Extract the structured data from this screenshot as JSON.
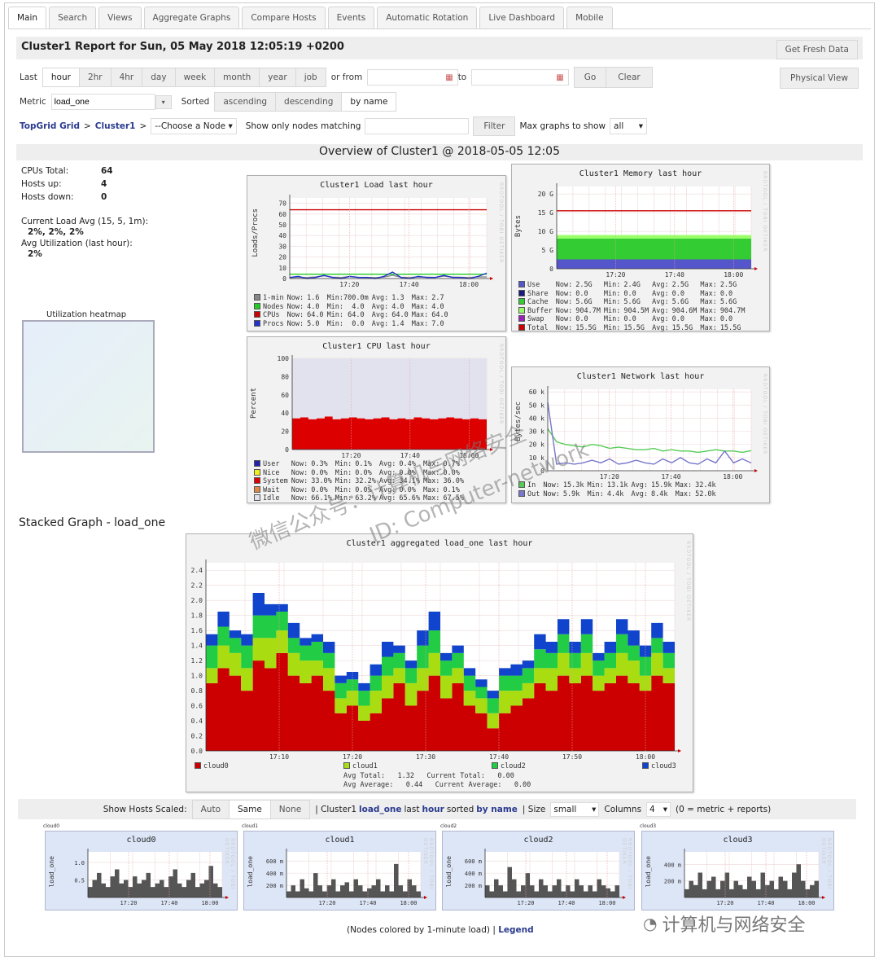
{
  "tabs": [
    "Main",
    "Search",
    "Views",
    "Aggregate Graphs",
    "Compare Hosts",
    "Events",
    "Automatic Rotation",
    "Live Dashboard",
    "Mobile"
  ],
  "header": {
    "title": "Cluster1 Report for Sun, 05 May 2018 12:05:19 +0200",
    "fresh": "Get Fresh Data",
    "physical": "Physical View"
  },
  "controls": {
    "last_label": "Last",
    "ranges": [
      "hour",
      "2hr",
      "4hr",
      "day",
      "week",
      "month",
      "year",
      "job"
    ],
    "active_range": "hour",
    "or_from": "or from",
    "to": "to",
    "go": "Go",
    "clear": "Clear",
    "metric_label": "Metric",
    "metric_value": "load_one",
    "sorted_label": "Sorted",
    "sorts": [
      "ascending",
      "descending",
      "by name"
    ],
    "active_sort": "by name",
    "crumb_grid": "TopGrid Grid",
    "crumb_sep": ">",
    "crumb_cluster": "Cluster1",
    "node_select": "--Choose a Node",
    "filter_label": "Show only nodes matching",
    "filter_btn": "Filter",
    "max_label": "Max graphs to show",
    "max_value": "all"
  },
  "overview": {
    "title": "Overview of Cluster1 @ 2018-05-05 12:05",
    "stats": [
      [
        "CPUs Total:",
        "64"
      ],
      [
        "Hosts up:",
        "4"
      ],
      [
        "Hosts down:",
        "0"
      ]
    ],
    "load_label": "Current Load Avg (15, 5, 1m):",
    "load_value": "2%, 2%, 2%",
    "util_label": "Avg Utilization (last hour):",
    "util_value": "2%",
    "heatmap_label": "Utilization heatmap"
  },
  "graphs": {
    "load": {
      "title": "Cluster1 Load last hour",
      "ylabel": "Loads/Procs",
      "ymax": 75,
      "yticks": [
        [
          0,
          "0"
        ],
        [
          10,
          "10"
        ],
        [
          20,
          "20"
        ],
        [
          30,
          "30"
        ],
        [
          40,
          "40"
        ],
        [
          50,
          "50"
        ],
        [
          60,
          "60"
        ],
        [
          70,
          "70"
        ]
      ],
      "xticks": [
        "17:20",
        "17:40",
        "18:00"
      ],
      "series": [
        {
          "name": "1-min",
          "color": "#888888",
          "type": "line",
          "values": [
            0.8,
            1.2,
            1.0,
            1.5,
            2.5,
            1.3,
            1.0,
            1.8,
            1.2,
            1.1,
            0.9,
            1.4,
            3.0,
            1.2,
            1.0,
            1.5,
            1.3,
            1.1,
            2.2,
            1.4,
            1.2,
            1.0,
            1.6,
            1.5
          ]
        },
        {
          "name": "Nodes",
          "color": "#22cc22",
          "type": "line",
          "values": [
            4,
            4
          ]
        },
        {
          "name": "CPUs",
          "color": "#cc0000",
          "type": "line",
          "values": [
            64,
            64
          ]
        },
        {
          "name": "Procs",
          "color": "#2233cc",
          "type": "line",
          "values": [
            1,
            2,
            0,
            1,
            3,
            1,
            0,
            2,
            1,
            1,
            0,
            2,
            6,
            1,
            0,
            2,
            1,
            1,
            3,
            1,
            1,
            0,
            2,
            5
          ]
        }
      ],
      "legend": [
        [
          "1-min",
          "Now:",
          "1.6",
          "Min:700.0m",
          "Avg:",
          "1.3",
          "Max:",
          "2.7"
        ],
        [
          "Nodes",
          "Now:",
          "4.0",
          "Min:  4.0",
          "Avg:",
          "4.0",
          "Max:",
          "4.0"
        ],
        [
          "CPUs",
          "Now:",
          "64.0",
          "Min: 64.0",
          "Avg:",
          "64.0",
          "Max:",
          "64.0"
        ],
        [
          "Procs",
          "Now:",
          "5.0",
          "Min:  0.0",
          "Avg:",
          "1.4",
          "Max:",
          "7.0"
        ]
      ]
    },
    "memory": {
      "title": "Cluster1 Memory last hour",
      "ylabel": "Bytes",
      "ymax": 22,
      "yticks": [
        [
          0,
          "0"
        ],
        [
          5,
          "5 G"
        ],
        [
          10,
          "10 G"
        ],
        [
          15,
          "15 G"
        ],
        [
          20,
          "20 G"
        ]
      ],
      "xticks": [
        "17:20",
        "17:40",
        "18:00"
      ],
      "series": [
        {
          "name": "Use",
          "color": "#5555cc",
          "type": "stack",
          "values": [
            2.5,
            2.5
          ]
        },
        {
          "name": "Share",
          "color": "#1a1a7a",
          "type": "stack",
          "values": [
            0,
            0
          ]
        },
        {
          "name": "Cache",
          "color": "#33cc33",
          "type": "stack",
          "values": [
            5.6,
            5.6
          ]
        },
        {
          "name": "Buffer",
          "color": "#99ff66",
          "type": "stack",
          "values": [
            0.9,
            0.9
          ]
        },
        {
          "name": "Swap",
          "color": "#9922bb",
          "type": "stack",
          "values": [
            0,
            0
          ]
        },
        {
          "name": "Total",
          "color": "#cc0000",
          "type": "line",
          "values": [
            15.5,
            15.5
          ]
        }
      ],
      "legend": [
        [
          "Use",
          "Now:",
          "2.5G",
          "Min:",
          "2.4G",
          "Avg:",
          "2.5G",
          "Max:",
          "2.5G"
        ],
        [
          "Share",
          "Now:",
          "0.0",
          "Min:",
          "0.0",
          "Avg:",
          "0.0",
          "Max:",
          "0.0"
        ],
        [
          "Cache",
          "Now:",
          "5.6G",
          "Min:",
          "5.6G",
          "Avg:",
          "5.6G",
          "Max:",
          "5.6G"
        ],
        [
          "Buffer",
          "Now:",
          "904.7M",
          "Min:",
          "904.5M",
          "Avg:",
          "904.6M",
          "Max:",
          "904.7M"
        ],
        [
          "Swap",
          "Now:",
          "0.0",
          "Min:",
          "0.0",
          "Avg:",
          "0.0",
          "Max:",
          "0.0"
        ],
        [
          "Total",
          "Now:",
          "15.5G",
          "Min:",
          "15.5G",
          "Avg:",
          "15.5G",
          "Max:",
          "15.5G"
        ]
      ]
    },
    "cpu": {
      "title": "Cluster1 CPU last hour",
      "ylabel": "Percent",
      "ymax": 100,
      "yticks": [
        [
          0,
          "0"
        ],
        [
          20,
          "20"
        ],
        [
          40,
          "40"
        ],
        [
          60,
          "60"
        ],
        [
          80,
          "80"
        ],
        [
          100,
          "100"
        ]
      ],
      "xticks": [
        "17:20",
        "17:40",
        "18:00"
      ],
      "series": [
        {
          "name": "User",
          "color": "#2222aa",
          "type": "stack",
          "values": [
            0.3,
            0.3
          ]
        },
        {
          "name": "Nice",
          "color": "#eeee22",
          "type": "stack",
          "values": [
            0,
            0
          ]
        },
        {
          "name": "System",
          "color": "#dd0000",
          "type": "stack",
          "values": [
            34,
            35,
            33,
            34,
            36,
            33,
            34,
            35,
            34,
            33,
            34,
            35,
            33,
            34,
            33,
            35,
            34,
            33,
            34,
            35,
            34,
            33,
            34,
            33
          ]
        },
        {
          "name": "Wait",
          "color": "#dd8844",
          "type": "stack",
          "values": [
            0,
            0
          ]
        },
        {
          "name": "Idle",
          "color": "#e2e2ee",
          "type": "fill",
          "values": [
            100,
            100
          ]
        }
      ],
      "legend": [
        [
          "User",
          "Now:",
          "0.3%",
          "Min:",
          "0.1%",
          "Avg:",
          "0.4%",
          "Max:",
          "0.7%"
        ],
        [
          "Nice",
          "Now:",
          "0.0%",
          "Min:",
          "0.0%",
          "Avg:",
          "0.0%",
          "Max:",
          "0.0%"
        ],
        [
          "System",
          "Now:",
          "33.0%",
          "Min:",
          "32.2%",
          "Avg:",
          "34.1%",
          "Max:",
          "36.0%"
        ],
        [
          "Wait",
          "Now:",
          "0.0%",
          "Min:",
          "0.0%",
          "Avg:",
          "0.0%",
          "Max:",
          "0.1%"
        ],
        [
          "Idle",
          "Now:",
          "66.1%",
          "Min:",
          "63.2%",
          "Avg:",
          "65.6%",
          "Max:",
          "67.5%"
        ]
      ]
    },
    "network": {
      "title": "Cluster1 Network last hour",
      "ylabel": "Bytes/sec",
      "ymax": 62,
      "yticks": [
        [
          0,
          "0"
        ],
        [
          10,
          "10 k"
        ],
        [
          20,
          "20 k"
        ],
        [
          30,
          "30 k"
        ],
        [
          40,
          "40 k"
        ],
        [
          50,
          "50 k"
        ],
        [
          60,
          "60 k"
        ]
      ],
      "xticks": [
        "17:20",
        "17:40",
        "18:00"
      ],
      "series": [
        {
          "name": "In",
          "color": "#55cc55",
          "type": "line",
          "values": [
            32,
            22,
            20,
            19,
            18,
            20,
            19,
            17,
            18,
            17,
            16,
            16,
            17,
            15,
            16,
            15,
            15,
            14,
            15,
            16,
            15,
            15,
            14,
            15.3
          ]
        },
        {
          "name": "Out",
          "color": "#7777cc",
          "type": "line",
          "values": [
            52,
            5,
            6,
            5,
            6,
            8,
            6,
            9,
            5,
            6,
            8,
            6,
            5,
            9,
            6,
            10,
            6,
            5,
            9,
            6,
            15,
            6,
            9,
            5.9
          ]
        }
      ],
      "legend": [
        [
          "In",
          "Now:",
          "15.3k",
          "Min:",
          "13.1k",
          "Avg:",
          "15.9k",
          "Max:",
          "32.4k"
        ],
        [
          "Out",
          "Now:",
          "5.9k",
          "Min:",
          "4.4k",
          "Avg:",
          "8.4k",
          "Max:",
          "52.0k"
        ]
      ]
    },
    "stacked": {
      "title": "Cluster1 aggregated load_one last hour",
      "ymax": 2.5,
      "yticks": [
        [
          0,
          "0.0"
        ],
        [
          0.2,
          "0.2"
        ],
        [
          0.4,
          "0.4"
        ],
        [
          0.6,
          "0.6"
        ],
        [
          0.8,
          "0.8"
        ],
        [
          1.0,
          "1.0"
        ],
        [
          1.2,
          "1.2"
        ],
        [
          1.4,
          "1.4"
        ],
        [
          1.6,
          "1.6"
        ],
        [
          1.8,
          "1.8"
        ],
        [
          2.0,
          "2.0"
        ],
        [
          2.2,
          "2.2"
        ],
        [
          2.4,
          "2.4"
        ]
      ],
      "xticks": [
        "17:10",
        "17:20",
        "17:30",
        "17:40",
        "17:50",
        "18:00"
      ],
      "series": [
        {
          "name": "cloud0",
          "color": "#cc0000",
          "type": "stack",
          "values": [
            0.9,
            1.1,
            1.0,
            0.8,
            1.2,
            1.1,
            1.3,
            1.0,
            0.9,
            1.0,
            0.8,
            0.5,
            0.6,
            0.4,
            0.5,
            0.7,
            0.9,
            0.6,
            0.8,
            1.0,
            0.7,
            0.9,
            0.6,
            0.5,
            0.3,
            0.5,
            0.6,
            0.7,
            0.9,
            0.8,
            1.0,
            0.9,
            1.0,
            0.8,
            0.9,
            1.0,
            0.9,
            0.8,
            1.0,
            0.9
          ]
        },
        {
          "name": "cloud1",
          "color": "#aadd11",
          "type": "stack",
          "values": [
            0.2,
            0.3,
            0.3,
            0.3,
            0.3,
            0.4,
            0.3,
            0.3,
            0.3,
            0.2,
            0.3,
            0.2,
            0.2,
            0.2,
            0.3,
            0.3,
            0.2,
            0.3,
            0.3,
            0.3,
            0.3,
            0.2,
            0.2,
            0.2,
            0.2,
            0.3,
            0.2,
            0.2,
            0.2,
            0.3,
            0.3,
            0.2,
            0.3,
            0.2,
            0.2,
            0.3,
            0.3,
            0.2,
            0.3,
            0.2
          ]
        },
        {
          "name": "cloud2",
          "color": "#22cc44",
          "type": "stack",
          "values": [
            0.3,
            0.25,
            0.2,
            0.3,
            0.3,
            0.3,
            0.25,
            0.2,
            0.2,
            0.25,
            0.2,
            0.2,
            0.15,
            0.2,
            0.2,
            0.25,
            0.2,
            0.2,
            0.3,
            0.3,
            0.2,
            0.2,
            0.2,
            0.15,
            0.2,
            0.2,
            0.2,
            0.2,
            0.25,
            0.2,
            0.25,
            0.2,
            0.25,
            0.2,
            0.2,
            0.25,
            0.2,
            0.25,
            0.2,
            0.2
          ]
        },
        {
          "name": "cloud3",
          "color": "#1144cc",
          "type": "stack",
          "values": [
            0.15,
            0.2,
            0.1,
            0.15,
            0.3,
            0.15,
            0.1,
            0.2,
            0.1,
            0.1,
            0.15,
            0.1,
            0.1,
            0.1,
            0.15,
            0.2,
            0.1,
            0.1,
            0.2,
            0.25,
            0.1,
            0.1,
            0.1,
            0.1,
            0.1,
            0.1,
            0.15,
            0.1,
            0.2,
            0.15,
            0.2,
            0.15,
            0.2,
            0.1,
            0.15,
            0.2,
            0.2,
            0.15,
            0.2,
            0.15
          ]
        }
      ],
      "legend_names": [
        "cloud0",
        "cloud1",
        "cloud2",
        "cloud3"
      ],
      "summary": [
        "Avg Total:   1.32   Current Total:   0.00",
        "Avg Average:   0.44   Current Average:   0.00"
      ]
    }
  },
  "rrd_credit": "RRDTOOL / TOBI OETIKER",
  "stacked_heading": "Stacked Graph - load_one",
  "bottombar": {
    "scaled_label": "Show Hosts Scaled:",
    "scales": [
      "Auto",
      "Same",
      "None"
    ],
    "active_scale": "Same",
    "desc_pre": "| Cluster1",
    "desc_metric": "load_one",
    "desc_mid": "last",
    "desc_range": "hour",
    "desc_sorted": "sorted",
    "desc_sort": "by name",
    "size_label": "| Size",
    "size_value": "small",
    "columns_label": "Columns",
    "columns_value": "4",
    "columns_note": "(0 = metric + reports)"
  },
  "hosts": [
    {
      "name": "cloud0",
      "ylabel": "load_one",
      "ymax": 1.3,
      "yticks": [
        [
          0.5,
          "0.5"
        ],
        [
          1.0,
          "1.0"
        ]
      ],
      "values": [
        0.3,
        0.5,
        0.7,
        0.4,
        0.3,
        0.6,
        0.8,
        0.4,
        0.5,
        0.3,
        0.6,
        0.4,
        0.5,
        0.7,
        0.3,
        0.4,
        0.5,
        0.3,
        0.6,
        0.8,
        0.4,
        0.3,
        0.5,
        0.7,
        0.3,
        0.4,
        0.5,
        0.9,
        0.4,
        0.3
      ]
    },
    {
      "name": "cloud1",
      "ylabel": "load_one",
      "ymax": 0.75,
      "yticks": [
        [
          0.2,
          "200 m"
        ],
        [
          0.4,
          "400 m"
        ],
        [
          0.6,
          "600 m"
        ]
      ],
      "values": [
        0.1,
        0.2,
        0.1,
        0.3,
        0.15,
        0.1,
        0.4,
        0.2,
        0.1,
        0.2,
        0.3,
        0.1,
        0.2,
        0.25,
        0.1,
        0.3,
        0.2,
        0.1,
        0.15,
        0.2,
        0.3,
        0.1,
        0.2,
        0.1,
        0.55,
        0.2,
        0.1,
        0.3,
        0.2,
        0.1
      ]
    },
    {
      "name": "cloud2",
      "ylabel": "load_one",
      "ymax": 0.75,
      "yticks": [
        [
          0.2,
          "200 m"
        ],
        [
          0.4,
          "400 m"
        ],
        [
          0.6,
          "600 m"
        ]
      ],
      "values": [
        0.2,
        0.1,
        0.3,
        0.2,
        0.1,
        0.5,
        0.3,
        0.1,
        0.2,
        0.4,
        0.2,
        0.1,
        0.3,
        0.2,
        0.1,
        0.2,
        0.3,
        0.1,
        0.2,
        0.1,
        0.3,
        0.2,
        0.1,
        0.2,
        0.1,
        0.3,
        0.2,
        0.15,
        0.1,
        0.2
      ]
    },
    {
      "name": "cloud3",
      "ylabel": "load_one",
      "ymax": 0.55,
      "yticks": [
        [
          0.2,
          "200 m"
        ],
        [
          0.4,
          "400 m"
        ]
      ],
      "values": [
        0.1,
        0.2,
        0.15,
        0.3,
        0.1,
        0.2,
        0.25,
        0.1,
        0.2,
        0.3,
        0.1,
        0.2,
        0.15,
        0.1,
        0.25,
        0.2,
        0.1,
        0.3,
        0.15,
        0.2,
        0.1,
        0.25,
        0.2,
        0.1,
        0.3,
        0.4,
        0.2,
        0.1,
        0.15,
        0.2
      ]
    }
  ],
  "host_xticks": [
    "17:20",
    "17:40",
    "18:00"
  ],
  "footer": {
    "note": "(Nodes colored by 1-minute load) |",
    "legend_link": "Legend"
  },
  "watermark": {
    "line1": "微信公众号：计算机与网络安全",
    "line2": "ID: Computer-network",
    "logo": "计算机与网络安全"
  }
}
